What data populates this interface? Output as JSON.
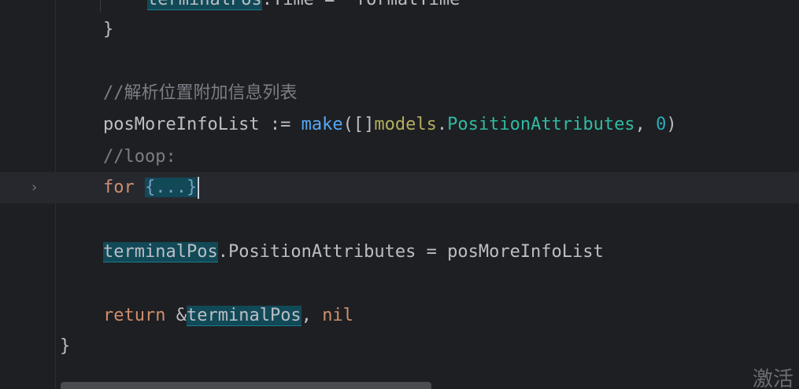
{
  "editor": {
    "lines": {
      "l0": {
        "ident": "terminalPos",
        "rest": ".Time = *formatTime"
      },
      "l1": {
        "brace": "}"
      },
      "l3": {
        "comment": "//解析位置附加信息列表"
      },
      "l4": {
        "var": "posMoreInfoList := ",
        "make": "make",
        "open": "([]",
        "pkg": "models",
        "dot": ".",
        "type": "PositionAttributes",
        "comma": ", ",
        "zero": "0",
        "close": ")"
      },
      "l5": {
        "comment": "//loop:"
      },
      "l6": {
        "kw": "for",
        "space": " ",
        "folded": "{...}"
      },
      "l8": {
        "ident": "terminalPos",
        "rest": ".PositionAttributes = posMoreInfoList"
      },
      "l10": {
        "kw": "return",
        "amp": " &",
        "ident": "terminalPos",
        "comma": ", ",
        "nil": "nil"
      },
      "l11": {
        "brace": "}"
      }
    },
    "fold_icon": "chevron-right-icon",
    "fold_glyph": "›"
  },
  "watermark": {
    "text": "激活"
  },
  "colors": {
    "background": "#1e1f22",
    "current_line": "#26282e",
    "keyword": "#cf8e6d",
    "function": "#56a8f5",
    "package": "#b3ae60",
    "type": "#2fbaa3",
    "number": "#2aacb8",
    "comment": "#7a7e85",
    "highlight": "#114957"
  }
}
